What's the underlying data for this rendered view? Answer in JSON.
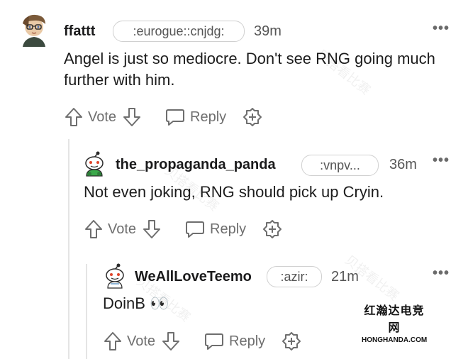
{
  "comments": [
    {
      "username": "ffattt",
      "flair": ":eurogue::cnjdg:",
      "time": "39m",
      "body": "Angel is just so mediocre. Don't see RNG going much further with him.",
      "vote_label": "Vote",
      "reply_label": "Reply"
    },
    {
      "username": "the_propaganda_panda",
      "flair": ":vnpv...",
      "time": "36m",
      "body": "Not even joking, RNG should pick up Cryin.",
      "vote_label": "Vote",
      "reply_label": "Reply"
    },
    {
      "username": "WeAllLoveTeemo",
      "flair": ":azir:",
      "time": "21m",
      "body": "DoinB 👀",
      "vote_label": "Vote",
      "reply_label": "Reply"
    }
  ],
  "watermark": {
    "cn": "红瀚达电竞网",
    "domain": "HONGHANDA.COM",
    "diagonal": "贝搭看比赛"
  },
  "colors": {
    "text": "#1c1c1c",
    "muted": "#6e6e6e",
    "flair_border": "#d0d0d0",
    "thread_line": "#e4e4e4"
  }
}
